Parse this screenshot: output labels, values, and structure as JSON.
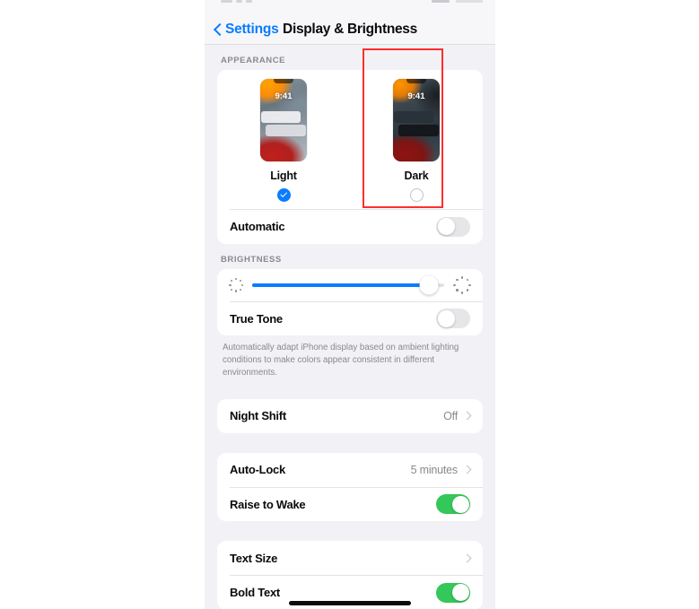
{
  "device": {
    "status_bar": {
      "icons": [
        "signal-icon",
        "wifi-icon",
        "battery-icon"
      ]
    },
    "home_indicator": "home-indicator"
  },
  "navbar": {
    "back_label": "Settings",
    "title": "Display & Brightness",
    "back_icon": "chevron-left-icon",
    "accent_color": "#0a7cff"
  },
  "appearance": {
    "header": "APPEARANCE",
    "options": [
      {
        "label": "Light",
        "time": "9:41",
        "selected": true
      },
      {
        "label": "Dark",
        "time": "9:41",
        "selected": false
      }
    ],
    "automatic": {
      "label": "Automatic",
      "value": "off"
    }
  },
  "brightness": {
    "header": "BRIGHTNESS",
    "slider": {
      "value": 92,
      "min_icon": "sun-small-icon",
      "max_icon": "sun-large-icon",
      "fill_color": "#0a7cff"
    },
    "true_tone": {
      "label": "True Tone",
      "value": "off"
    },
    "caption": "Automatically adapt iPhone display based on ambient lighting conditions to make colors appear consistent in different environments."
  },
  "night_shift": {
    "label": "Night Shift",
    "value": "Off",
    "chevron": "chevron-right-icon"
  },
  "lock_group": {
    "auto_lock": {
      "label": "Auto-Lock",
      "value": "5 minutes",
      "chevron": "chevron-right-icon"
    },
    "raise_to_wake": {
      "label": "Raise to Wake",
      "value": "on"
    }
  },
  "text_group": {
    "text_size": {
      "label": "Text Size",
      "chevron": "chevron-right-icon"
    },
    "bold_text": {
      "label": "Bold Text",
      "value": "on"
    }
  },
  "annotation": {
    "type": "highlight-rectangle",
    "color": "#fd2e2e",
    "target": "Dark"
  },
  "colors": {
    "toggle_on": "#34c759",
    "toggle_off": "#e6e6e9",
    "accent": "#0a7cff",
    "background": "#f2f1f6"
  }
}
